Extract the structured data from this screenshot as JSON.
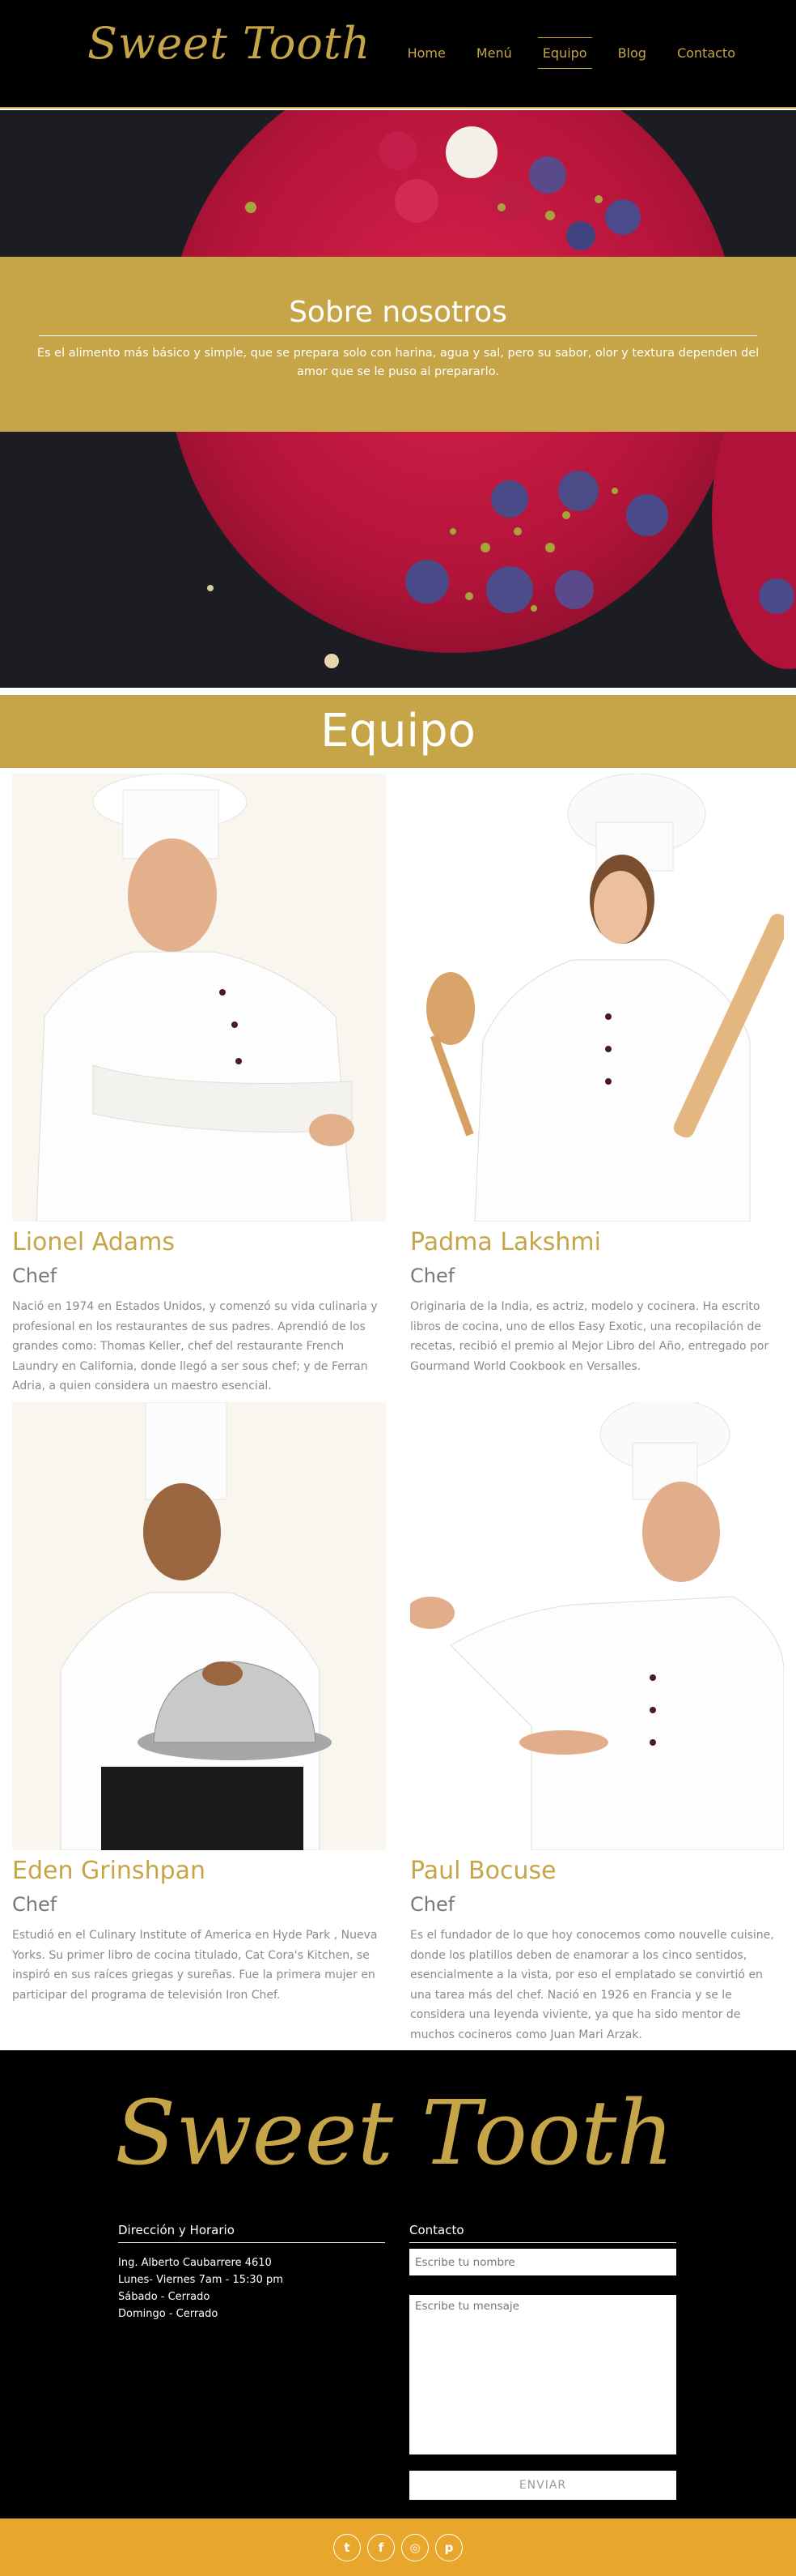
{
  "brand": {
    "logo": "Sweet Tooth"
  },
  "nav": {
    "items": [
      {
        "label": "Home",
        "active": false
      },
      {
        "label": "Menú",
        "active": false
      },
      {
        "label": "Equipo",
        "active": true
      },
      {
        "label": "Blog",
        "active": false
      },
      {
        "label": "Contacto",
        "active": false
      }
    ]
  },
  "about": {
    "title": "Sobre nosotros",
    "text": "Es el alimento más básico y simple, que se prepara solo con harina, agua y sal, pero su sabor, olor y textura dependen del amor que se le puso al prepararlo."
  },
  "team": {
    "title": "Equipo",
    "members": [
      {
        "name": "Lionel Adams",
        "role": "Chef",
        "bio": "Nació en 1974 en Estados Unidos, y comenzó su vida culinaria y profesional en los restaurantes de sus padres. Aprendió de los grandes como: Thomas Keller, chef del restaurante French Laundry en California, donde llegó a ser sous chef; y de Ferran Adria, a quien considera un maestro esencial."
      },
      {
        "name": "Padma Lakshmi",
        "role": "Chef",
        "bio": "Originaria de la India, es actriz, modelo y cocinera. Ha escrito libros de cocina, uno de ellos Easy Exotic, una recopilación de recetas, recibió el premio al Mejor Libro del Año, entregado por Gourmand World Cookbook en Versalles."
      },
      {
        "name": "Eden Grinshpan",
        "role": "Chef",
        "bio": "Estudió en el Culinary Institute of America en Hyde Park , Nueva Yorks. Su primer libro de cocina titulado, Cat Cora's Kitchen, se inspiró en sus raíces griegas y sureñas. Fue la primera mujer en participar del programa de televisión Iron Chef."
      },
      {
        "name": "Paul Bocuse",
        "role": "Chef",
        "bio": "Es el fundador de lo que hoy conocemos como nouvelle cuisine, donde los platillos deben de enamorar a los cinco sentidos, esencialmente a la vista, por eso el emplatado se convirtió en una tarea más del chef. Nació en 1926 en Francia y se le considera una leyenda viviente, ya que ha sido mentor de muchos cocineros como Juan Mari Arzak."
      }
    ]
  },
  "footer": {
    "logo": "Sweet Tooth",
    "address_title": "Dirección y Horario",
    "address_lines": [
      "Ing. Alberto Caubarrere 4610",
      "Lunes- Viernes 7am - 15:30 pm",
      "Sábado - Cerrado",
      "Domingo - Cerrado"
    ],
    "contact_title": "Contacto",
    "name_placeholder": "Escribe tu nombre",
    "message_placeholder": "Escribe tu mensaje",
    "send_label": "ENVIAR"
  },
  "social": [
    {
      "icon": "twitter-icon",
      "glyph": "t"
    },
    {
      "icon": "facebook-icon",
      "glyph": "f"
    },
    {
      "icon": "instagram-icon",
      "glyph": "◎"
    },
    {
      "icon": "pinterest-icon",
      "glyph": "p"
    }
  ],
  "colors": {
    "gold": "#c6a548",
    "black": "#000000",
    "orange": "#e8a72c"
  }
}
